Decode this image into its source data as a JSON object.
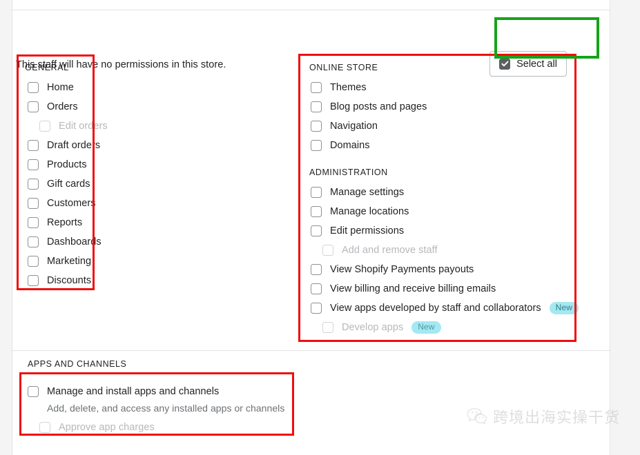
{
  "intro": {
    "text": "This staff will have no permissions in this store."
  },
  "select_all": {
    "label": "Select all",
    "checked": true,
    "icon": "checkmark-icon"
  },
  "sections": {
    "general": {
      "title": "GENERAL",
      "items": [
        {
          "label": "Home",
          "indent": 0,
          "disabled": false
        },
        {
          "label": "Orders",
          "indent": 0,
          "disabled": false
        },
        {
          "label": "Edit orders",
          "indent": 1,
          "disabled": true
        },
        {
          "label": "Draft orders",
          "indent": 0,
          "disabled": false
        },
        {
          "label": "Products",
          "indent": 0,
          "disabled": false
        },
        {
          "label": "Gift cards",
          "indent": 0,
          "disabled": false
        },
        {
          "label": "Customers",
          "indent": 0,
          "disabled": false
        },
        {
          "label": "Reports",
          "indent": 0,
          "disabled": false
        },
        {
          "label": "Dashboards",
          "indent": 0,
          "disabled": false
        },
        {
          "label": "Marketing",
          "indent": 0,
          "disabled": false
        },
        {
          "label": "Discounts",
          "indent": 0,
          "disabled": false
        }
      ]
    },
    "online_store": {
      "title": "ONLINE STORE",
      "items": [
        {
          "label": "Themes",
          "indent": 0,
          "disabled": false
        },
        {
          "label": "Blog posts and pages",
          "indent": 0,
          "disabled": false
        },
        {
          "label": "Navigation",
          "indent": 0,
          "disabled": false
        },
        {
          "label": "Domains",
          "indent": 0,
          "disabled": false
        }
      ]
    },
    "administration": {
      "title": "ADMINISTRATION",
      "items": [
        {
          "label": "Manage settings",
          "indent": 0,
          "disabled": false,
          "badge": ""
        },
        {
          "label": "Manage locations",
          "indent": 0,
          "disabled": false,
          "badge": ""
        },
        {
          "label": "Edit permissions",
          "indent": 0,
          "disabled": false,
          "badge": ""
        },
        {
          "label": "Add and remove staff",
          "indent": 1,
          "disabled": true,
          "badge": ""
        },
        {
          "label": "View Shopify Payments payouts",
          "indent": 0,
          "disabled": false,
          "badge": ""
        },
        {
          "label": "View billing and receive billing emails",
          "indent": 0,
          "disabled": false,
          "badge": ""
        },
        {
          "label": "View apps developed by staff and collaborators",
          "indent": 0,
          "disabled": false,
          "badge": "New"
        },
        {
          "label": "Develop apps",
          "indent": 1,
          "disabled": true,
          "badge": "New"
        }
      ]
    },
    "apps_and_channels": {
      "title": "APPS AND CHANNELS",
      "items": [
        {
          "label": "Manage and install apps and channels",
          "indent": 0,
          "disabled": false
        },
        {
          "label": "Approve app charges",
          "indent": 1,
          "disabled": true
        }
      ],
      "helper_text": "Add, delete, and access any installed apps or channels"
    }
  },
  "watermark": {
    "text": "跨境出海实操干货",
    "icon": "wechat-icon"
  },
  "colors": {
    "annotation_red": "#f00d0d",
    "annotation_green": "#16a319",
    "badge_bg": "#a4e8f2",
    "badge_text": "#347c84",
    "text_primary": "#202223",
    "text_subdued": "#6d7175",
    "text_disabled": "#b5b8bb",
    "checkbox_border": "#8c9196",
    "card_bg": "#ffffff",
    "page_bg": "#f4f4f4"
  }
}
